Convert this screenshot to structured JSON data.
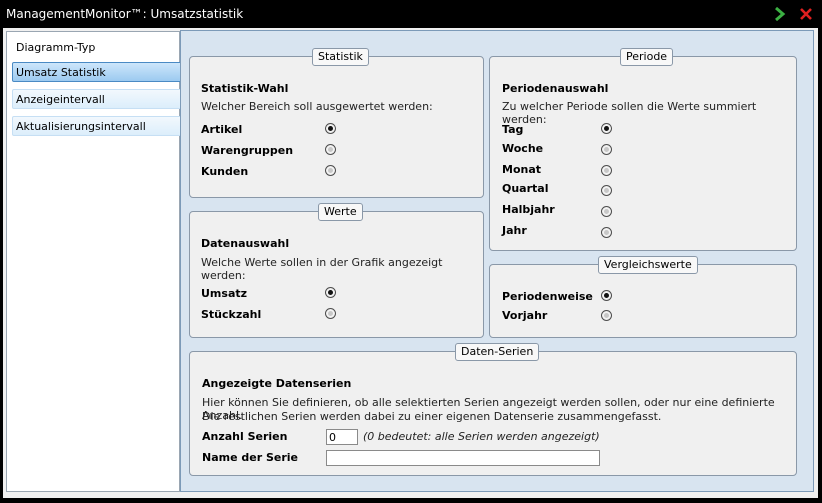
{
  "window": {
    "title": "ManagementMonitor™: Umsatzstatistik"
  },
  "colors": {
    "title_bg": "#000000",
    "accent_ok": "#3cb043",
    "accent_close": "#e02020",
    "nav_active": "#9ccaf0"
  },
  "sidebar": {
    "items": [
      {
        "label": "Diagramm-Typ"
      },
      {
        "label": "Umsatz Statistik"
      },
      {
        "label": "Anzeigeintervall"
      },
      {
        "label": "Aktualisierungsintervall"
      }
    ],
    "selected": "Umsatz Statistik"
  },
  "statistik": {
    "legend": "Statistik",
    "title": "Statistik-Wahl",
    "desc": "Welcher Bereich soll ausgewertet werden:",
    "options": [
      "Artikel",
      "Warengruppen",
      "Kunden"
    ],
    "selected": "Artikel"
  },
  "werte": {
    "legend": "Werte",
    "title": "Datenauswahl",
    "desc": "Welche Werte sollen in der Grafik angezeigt werden:",
    "options": [
      "Umsatz",
      "Stückzahl"
    ],
    "selected": "Umsatz"
  },
  "periode": {
    "legend": "Periode",
    "title": "Periodenauswahl",
    "desc": "Zu welcher Periode sollen die Werte summiert werden:",
    "options": [
      "Tag",
      "Woche",
      "Monat",
      "Quartal",
      "Halbjahr",
      "Jahr"
    ],
    "selected": "Tag"
  },
  "vergleich": {
    "legend": "Vergleichswerte",
    "options": [
      "Periodenweise",
      "Vorjahr"
    ],
    "selected": "Periodenweise"
  },
  "daten_serien": {
    "legend": "Daten-Serien",
    "title": "Angezeigte Datenserien",
    "desc1": "Hier können Sie definieren, ob alle selektierten Serien angezeigt werden sollen, oder nur eine definierte Anzahl.",
    "desc2": "Die restlichen Serien werden dabei zu einer eigenen Datenserie zusammengefasst.",
    "anzahl_label": "Anzahl Serien",
    "anzahl_value": "0",
    "anzahl_hint": "(0 bedeutet: alle Serien werden angezeigt)",
    "name_label": "Name der Serie",
    "name_value": ""
  }
}
